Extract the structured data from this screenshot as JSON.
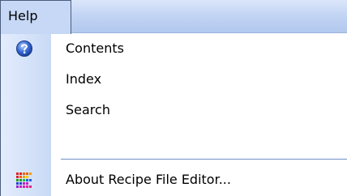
{
  "menubar": {
    "title": "Help"
  },
  "menu": {
    "items": [
      {
        "label": "Contents",
        "icon": "help-question-icon"
      },
      {
        "label": "Index"
      },
      {
        "label": "Search"
      },
      {
        "label": "About Recipe File Editor...",
        "icon": "app-grid-icon"
      }
    ]
  },
  "colors": {
    "menubar": "#c3d5f4",
    "icon_strip": "#d4e2f8",
    "separator": "#6f8fc6",
    "title_border": "#4a5d7e"
  }
}
